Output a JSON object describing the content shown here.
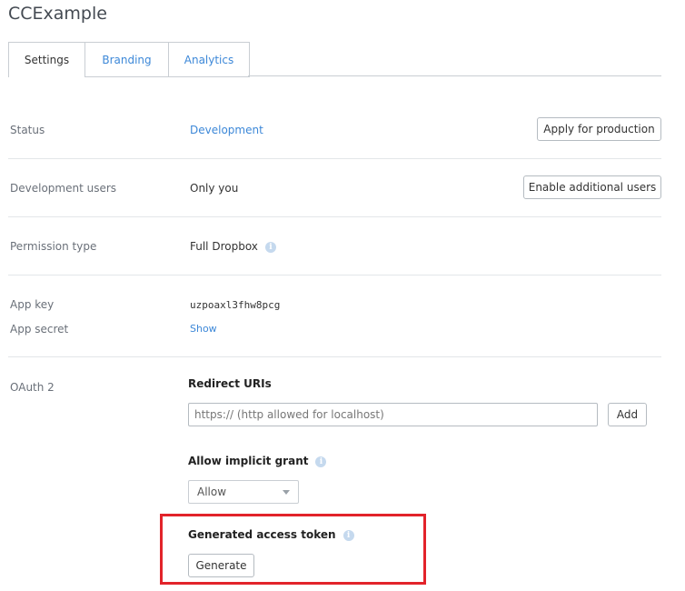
{
  "app": {
    "title": "CCExample"
  },
  "tabs": [
    {
      "label": "Settings",
      "active": true
    },
    {
      "label": "Branding",
      "active": false
    },
    {
      "label": "Analytics",
      "active": false
    }
  ],
  "status": {
    "label": "Status",
    "value": "Development",
    "button_label": "Apply for production"
  },
  "dev_users": {
    "label": "Development users",
    "value": "Only you",
    "button_label": "Enable additional users"
  },
  "permission": {
    "label": "Permission type",
    "value": "Full Dropbox",
    "icon": "info-icon"
  },
  "keys": {
    "app_key_label": "App key",
    "app_key_value": "uzpoaxl3fhw8pcg",
    "app_secret_label": "App secret",
    "app_secret_link": "Show"
  },
  "oauth": {
    "label": "OAuth 2",
    "redirect_heading": "Redirect URIs",
    "redirect_placeholder": "https:// (http allowed for localhost)",
    "redirect_value": "",
    "add_button_label": "Add",
    "implicit_heading": "Allow implicit grant",
    "implicit_selected": "Allow",
    "token_heading": "Generated access token",
    "generate_button_label": "Generate"
  },
  "colors": {
    "link": "#3d88d8",
    "highlight": "#e2232a",
    "info_icon": "#c5d9ee"
  }
}
